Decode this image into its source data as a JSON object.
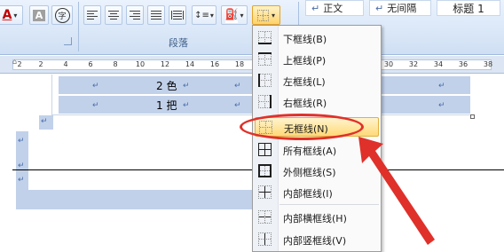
{
  "ribbon": {
    "font_color_letter": "A",
    "char_shading_letter": "A",
    "enclose_char": "字",
    "paragraph_group_label": "段落",
    "styles": [
      {
        "icon": "↵",
        "label": "正文"
      },
      {
        "icon": "↵",
        "label": "无间隔"
      },
      {
        "icon": "",
        "label": "标题 1"
      }
    ]
  },
  "ruler": {
    "ticks": [
      "2",
      "2",
      "4",
      "6",
      "8",
      "10",
      "12",
      "14",
      "16",
      "18",
      "30",
      "32",
      "34",
      "36",
      "38"
    ]
  },
  "document": {
    "row1_text": "2 色",
    "row2_text": "1 把",
    "para_mark": "↵"
  },
  "border_menu": {
    "items": [
      {
        "label": "下框线(B)",
        "icon": "bottom-border-icon"
      },
      {
        "label": "上框线(P)",
        "icon": "top-border-icon"
      },
      {
        "label": "左框线(L)",
        "icon": "left-border-icon"
      },
      {
        "label": "右框线(R)",
        "icon": "right-border-icon"
      },
      {
        "label": "无框线(N)",
        "icon": "no-border-icon",
        "highlighted": true
      },
      {
        "label": "所有框线(A)",
        "icon": "all-borders-icon"
      },
      {
        "label": "外侧框线(S)",
        "icon": "outside-borders-icon"
      },
      {
        "label": "内部框线(I)",
        "icon": "inside-borders-icon"
      },
      {
        "label": "内部横框线(H)",
        "icon": "inside-horizontal-border-icon"
      },
      {
        "label": "内部竖框线(V)",
        "icon": "inside-vertical-border-icon"
      }
    ]
  },
  "colors": {
    "highlight": "#ffd977",
    "annotation": "#e0302a",
    "table_shading": "#c1d1ea"
  }
}
